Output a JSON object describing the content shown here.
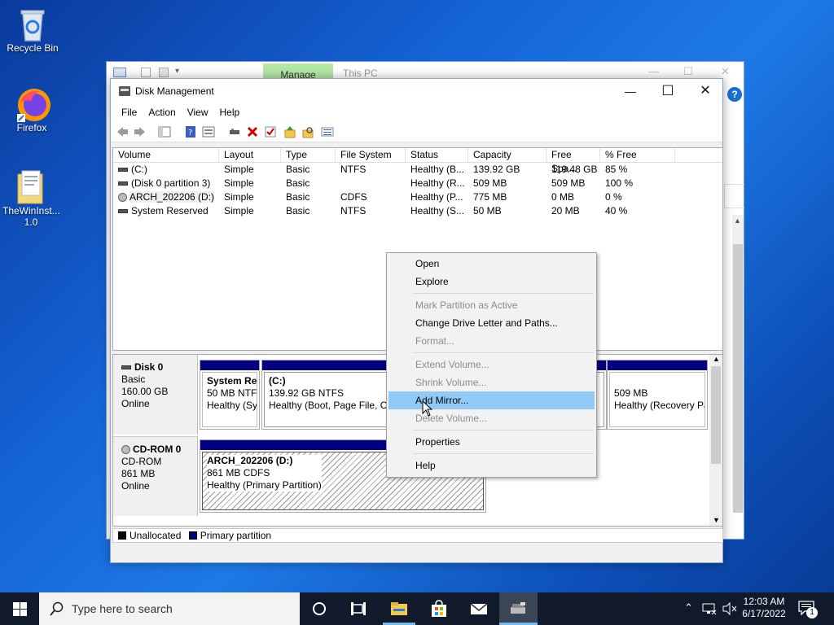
{
  "desktop": {
    "icons": [
      {
        "label": "Recycle Bin"
      },
      {
        "label": "Firefox"
      },
      {
        "label": "TheWinInst... 1.0"
      }
    ]
  },
  "bg_window": {
    "manage_tab": "Manage",
    "title": "This PC"
  },
  "window": {
    "title": "Disk Management",
    "menu": [
      "File",
      "Action",
      "View",
      "Help"
    ]
  },
  "volumes": {
    "columns": [
      "Volume",
      "Layout",
      "Type",
      "File System",
      "Status",
      "Capacity",
      "Free Spa...",
      "% Free"
    ],
    "rows": [
      {
        "volume": "(C:)",
        "layout": "Simple",
        "type": "Basic",
        "fs": "NTFS",
        "status": "Healthy (B...",
        "capacity": "139.92 GB",
        "free": "119.48 GB",
        "pct": "85 %",
        "icon": "drive-icon"
      },
      {
        "volume": "(Disk 0 partition 3)",
        "layout": "Simple",
        "type": "Basic",
        "fs": "",
        "status": "Healthy (R...",
        "capacity": "509 MB",
        "free": "509 MB",
        "pct": "100 %",
        "icon": "drive-icon"
      },
      {
        "volume": "ARCH_202206 (D:)",
        "layout": "Simple",
        "type": "Basic",
        "fs": "CDFS",
        "status": "Healthy (P...",
        "capacity": "775 MB",
        "free": "0 MB",
        "pct": "0 %",
        "icon": "cdrom-icon"
      },
      {
        "volume": "System Reserved",
        "layout": "Simple",
        "type": "Basic",
        "fs": "NTFS",
        "status": "Healthy (S...",
        "capacity": "50 MB",
        "free": "20 MB",
        "pct": "40 %",
        "icon": "drive-icon"
      }
    ]
  },
  "disks": {
    "disk0": {
      "name": "Disk 0",
      "type": "Basic",
      "size": "160.00 GB",
      "state": "Online",
      "partitions": [
        {
          "name": "System Re:",
          "line2": "50 MB NTFS",
          "line3": "Healthy (Sy"
        },
        {
          "name": "(C:)",
          "line2": "139.92 GB NTFS",
          "line3": "Healthy (Boot, Page File, Cra"
        },
        {
          "name": "",
          "line2": "509 MB",
          "line3": "Healthy (Recovery Pa"
        }
      ]
    },
    "cdrom0": {
      "name": "CD-ROM 0",
      "type": "CD-ROM",
      "size": "861 MB",
      "state": "Online",
      "partitions": [
        {
          "name": "ARCH_202206  (D:)",
          "line2": "861 MB CDFS",
          "line3": "Healthy (Primary Partition)"
        }
      ]
    }
  },
  "legend": {
    "unallocated": "Unallocated",
    "primary": "Primary partition"
  },
  "context_menu": {
    "items": [
      {
        "label": "Open",
        "enabled": true
      },
      {
        "label": "Explore",
        "enabled": true
      },
      {
        "label": "Mark Partition as Active",
        "enabled": false
      },
      {
        "label": "Change Drive Letter and Paths...",
        "enabled": true
      },
      {
        "label": "Format...",
        "enabled": false
      },
      {
        "label": "Extend Volume...",
        "enabled": false
      },
      {
        "label": "Shrink Volume...",
        "enabled": false
      },
      {
        "label": "Add Mirror...",
        "enabled": true,
        "hover": true
      },
      {
        "label": "Delete Volume...",
        "enabled": false
      },
      {
        "label": "Properties",
        "enabled": true
      },
      {
        "label": "Help",
        "enabled": true
      }
    ]
  },
  "taskbar": {
    "search_placeholder": "Type here to search",
    "time": "12:03 AM",
    "date": "6/17/2022",
    "notification_count": "1"
  },
  "colors": {
    "primary_partition": "#000080",
    "menu_hover": "#91c9f7",
    "manage_tab": "#b4e8a6"
  }
}
